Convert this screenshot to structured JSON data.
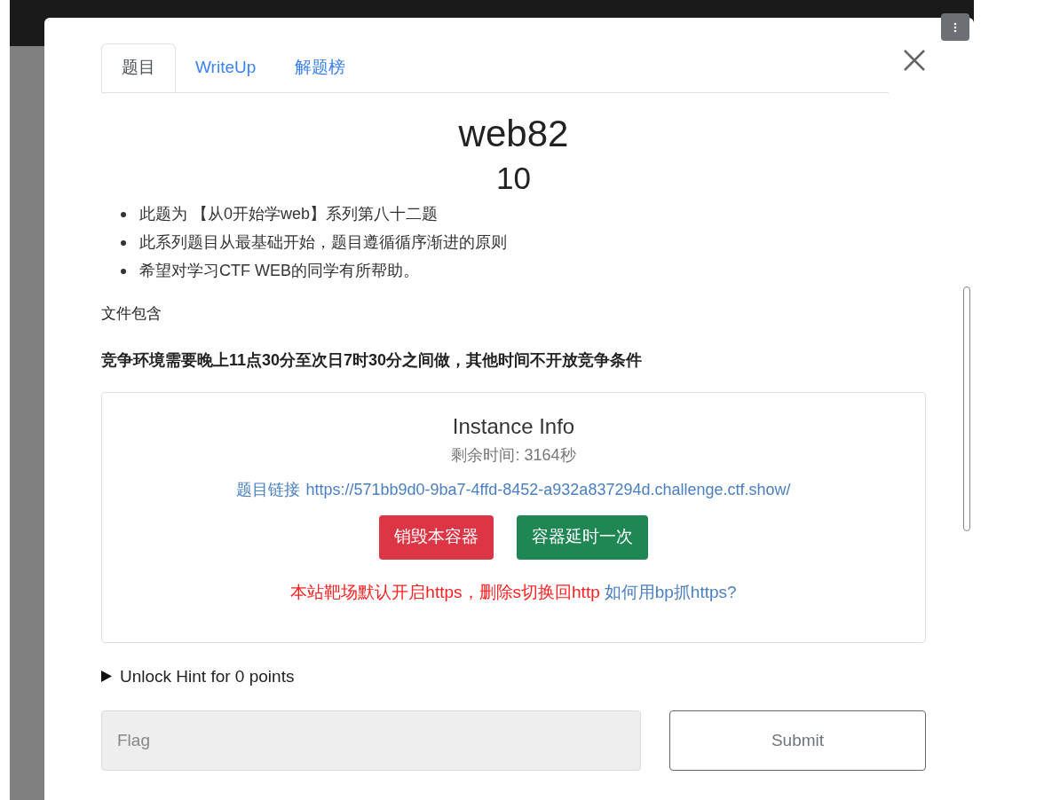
{
  "tabs": [
    {
      "label": "题目",
      "selected": true
    },
    {
      "label": "WriteUp",
      "selected": false
    },
    {
      "label": "解题榜",
      "selected": false
    }
  ],
  "challenge": {
    "name": "web82",
    "points": "10"
  },
  "description": {
    "bullets": [
      "此题为 【从0开始学web】系列第八十二题",
      "此系列题目从最基础开始，题目遵循循序渐进的原则",
      "希望对学习CTF WEB的同学有所帮助。"
    ],
    "category": "文件包含",
    "notice": "竞争环境需要晚上11点30分至次日7时30分之间做，其他时间不开放竞争条件"
  },
  "instance": {
    "title": "Instance Info",
    "remaining": "剩余时间: 3164秒",
    "link_label": "题目链接",
    "link_url": "https://571bb9d0-9ba7-4ffd-8452-a932a837294d.challenge.ctf.show/",
    "buttons": [
      {
        "label": "销毁本容器",
        "kind": "danger"
      },
      {
        "label": "容器延时一次",
        "kind": "success"
      }
    ],
    "warning": "本站靶场默认开启https，删除s切换回http",
    "help_link": "如何用bp抓https?"
  },
  "hint": {
    "label": "Unlock Hint for 0 points",
    "expanded": false
  },
  "flag": {
    "placeholder": "Flag",
    "submit": "Submit"
  }
}
